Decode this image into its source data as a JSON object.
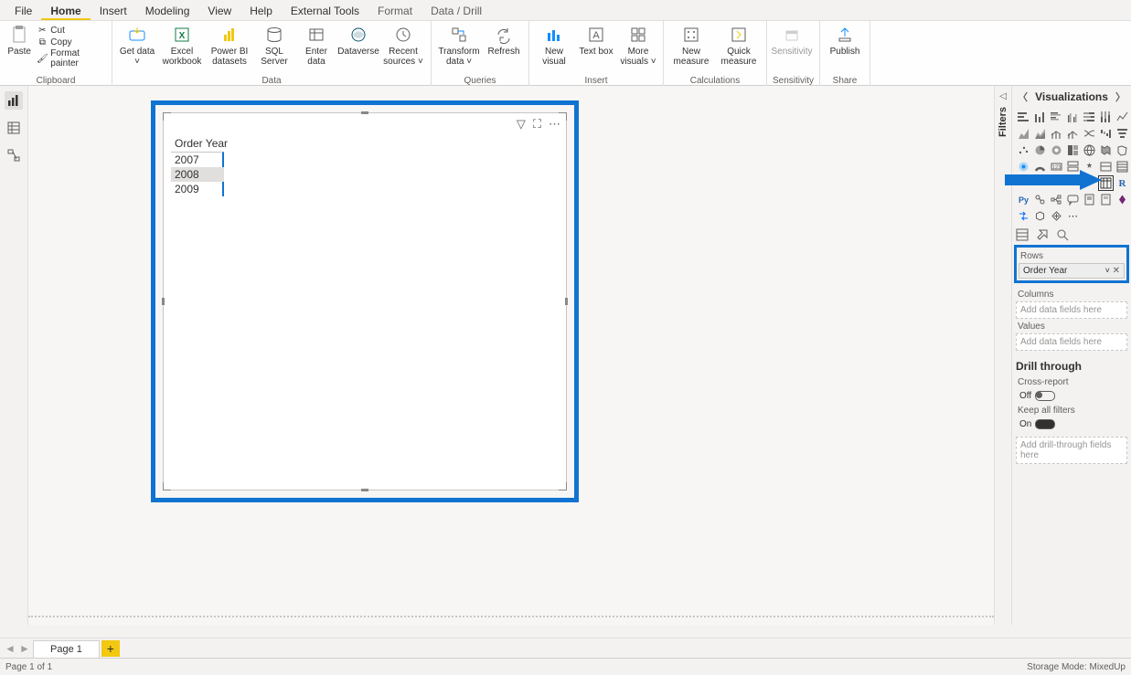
{
  "tabs": {
    "file": "File",
    "home": "Home",
    "insert": "Insert",
    "modeling": "Modeling",
    "view": "View",
    "help": "Help",
    "external": "External Tools",
    "format": "Format",
    "drill": "Data / Drill"
  },
  "ribbon": {
    "clipboard": {
      "label": "Clipboard",
      "paste": "Paste",
      "cut": "Cut",
      "copy": "Copy",
      "painter": "Format painter"
    },
    "data": {
      "label": "Data",
      "get": "Get data",
      "excel": "Excel workbook",
      "pbi": "Power BI datasets",
      "sql": "SQL Server",
      "enter": "Enter data",
      "dataverse": "Dataverse",
      "recent": "Recent sources",
      "arrow": "˅"
    },
    "queries": {
      "label": "Queries",
      "transform": "Transform data",
      "refresh": "Refresh"
    },
    "insert": {
      "label": "Insert",
      "newvis": "New visual",
      "textbox": "Text box",
      "more": "More visuals"
    },
    "calc": {
      "label": "Calculations",
      "newmeasure": "New measure",
      "quick": "Quick measure"
    },
    "sens": {
      "label": "Sensitivity",
      "btn": "Sensitivity"
    },
    "share": {
      "label": "Share",
      "publish": "Publish"
    }
  },
  "canvas": {
    "visual": {
      "title": "Order Year",
      "rows": [
        "2007",
        "2008",
        "2009"
      ],
      "selectedIndex": 1
    }
  },
  "filters": {
    "label": "Filters"
  },
  "viz": {
    "title": "Visualizations",
    "rows_label": "Rows",
    "rows_field": "Order Year",
    "cols_label": "Columns",
    "vals_label": "Values",
    "placeholder": "Add data fields here",
    "drill_title": "Drill through",
    "cross": "Cross-report",
    "cross_state": "Off",
    "keep": "Keep all filters",
    "keep_state": "On",
    "drill_placeholder": "Add drill-through fields here"
  },
  "pages": {
    "page1": "Page 1"
  },
  "status": {
    "left": "Page 1 of 1",
    "right": "Storage Mode: MixedUp"
  }
}
